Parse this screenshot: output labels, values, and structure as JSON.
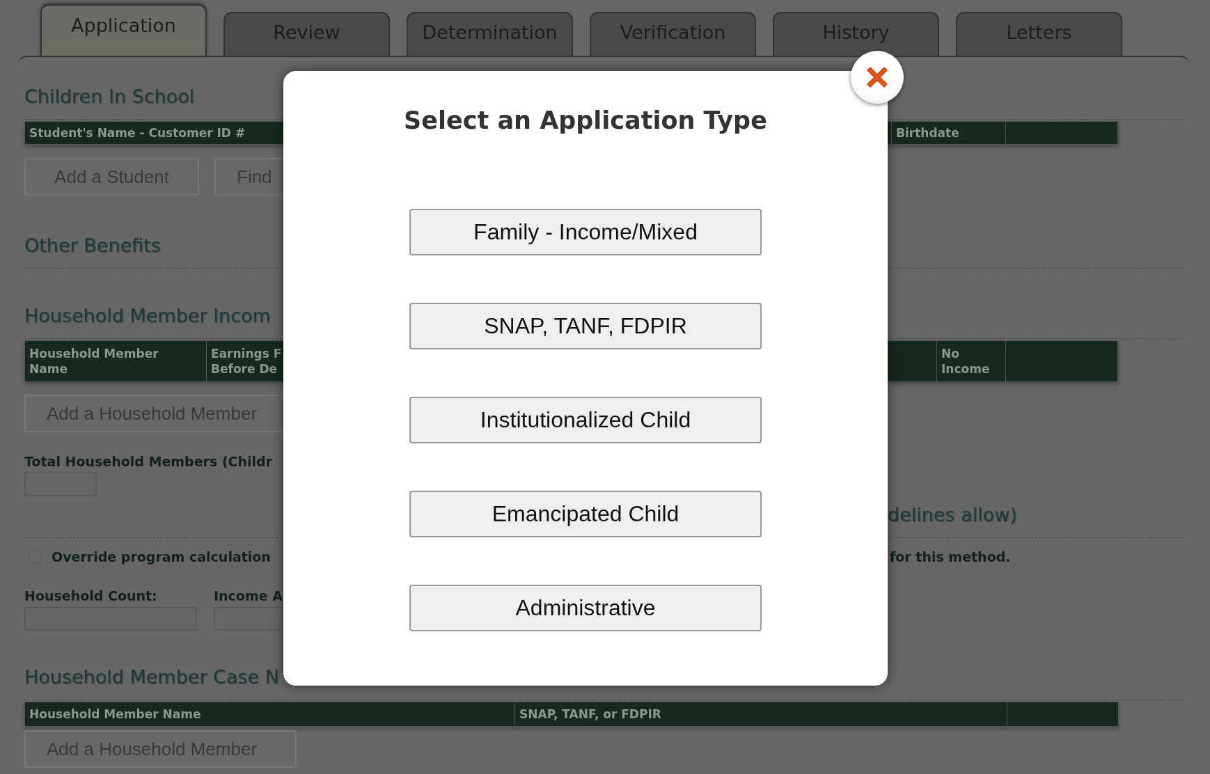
{
  "tabs": [
    {
      "label": "Application",
      "selected": true
    },
    {
      "label": "Review",
      "selected": false
    },
    {
      "label": "Determination",
      "selected": false
    },
    {
      "label": "Verification",
      "selected": false
    },
    {
      "label": "History",
      "selected": false
    },
    {
      "label": "Letters",
      "selected": false
    }
  ],
  "children_in_school": {
    "heading": "Children In School",
    "columns": [
      "Student's Name - Customer ID #",
      "Birthdate"
    ],
    "buttons": [
      "Add a Student",
      "Find"
    ]
  },
  "other_benefits": {
    "heading": "Other Benefits"
  },
  "household_member_income": {
    "heading": "Household Member Incom",
    "columns": [
      "Household Member Name",
      "Earnings F\nBefore De",
      "No Income"
    ],
    "add_button": "Add a Household Member",
    "total_label": "Total Household Members (Childr"
  },
  "guidelines": {
    "heading_end": "delines allow)",
    "override": {
      "label": "Override program calculation",
      "checked": false,
      "note_end": "for this method."
    },
    "household_count_label": "Household Count:",
    "income_label": "Income A"
  },
  "case_numbers": {
    "heading": "Household Member Case N",
    "columns": [
      "Household Member Name",
      "SNAP, TANF, or FDPIR"
    ],
    "add_button": "Add a Household Member"
  },
  "modal": {
    "title": "Select an Application Type",
    "options": [
      "Family - Income/Mixed",
      "SNAP, TANF, FDPIR",
      "Institutionalized Child",
      "Emancipated Child",
      "Administrative"
    ]
  }
}
